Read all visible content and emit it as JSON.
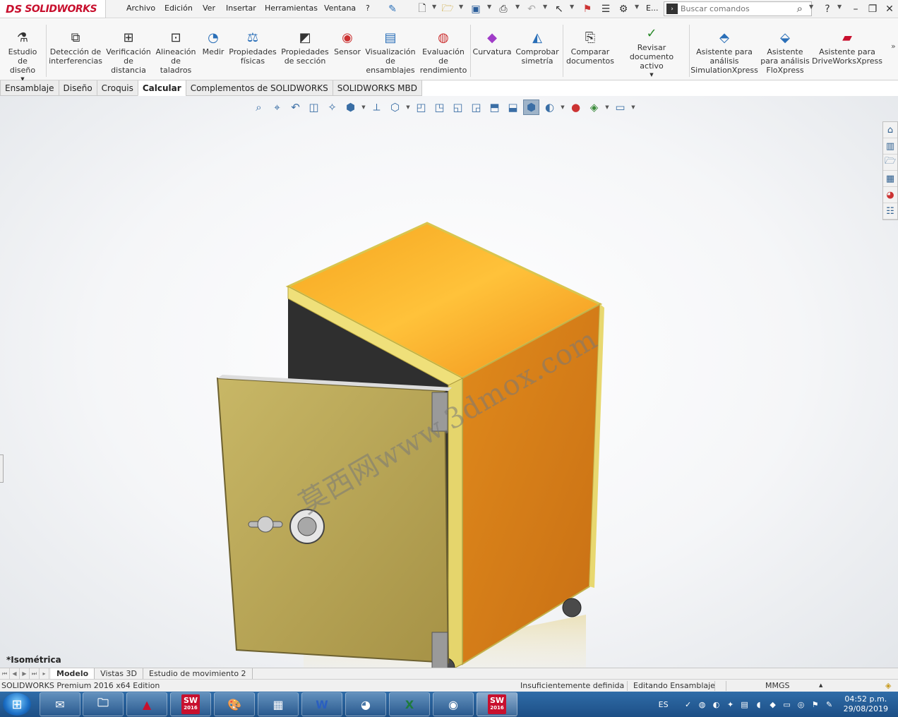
{
  "app": {
    "logo_ds": "DS",
    "logo_brand": "SOLIDWORKS"
  },
  "menu": [
    "Archivo",
    "Edición",
    "Ver",
    "Insertar",
    "Herramientas",
    "Ventana",
    "?"
  ],
  "quick_access": {
    "overflow_label": "E..."
  },
  "search": {
    "placeholder": "Buscar comandos"
  },
  "commands": [
    {
      "label": "Estudio de\ndiseño",
      "icon": "design-study-icon"
    },
    {
      "label": "Detección de\ninterferencias",
      "icon": "interference-icon"
    },
    {
      "label": "Verificación\nde\ndistancia",
      "icon": "clearance-icon"
    },
    {
      "label": "Alineación\nde\ntaladros",
      "icon": "hole-alignment-icon"
    },
    {
      "label": "Medir",
      "icon": "measure-icon"
    },
    {
      "label": "Propiedades\nfísicas",
      "icon": "mass-properties-icon"
    },
    {
      "label": "Propiedades\nde sección",
      "icon": "section-properties-icon"
    },
    {
      "label": "Sensor",
      "icon": "sensor-icon"
    },
    {
      "label": "Visualización\nde\nensamblajes",
      "icon": "assembly-visualization-icon"
    },
    {
      "label": "Evaluación\nde\nrendimiento",
      "icon": "performance-evaluation-icon"
    },
    {
      "label": "Curvatura",
      "icon": "curvature-icon"
    },
    {
      "label": "Comprobar\nsimetría",
      "icon": "symmetry-check-icon"
    },
    {
      "label": "Comparar\ndocumentos",
      "icon": "compare-documents-icon"
    },
    {
      "label": "Revisar\ndocumento activo",
      "icon": "check-active-document-icon"
    },
    {
      "label": "Asistente para\nanálisis\nSimulationXpress",
      "icon": "simulationxpress-icon"
    },
    {
      "label": "Asistente\npara análisis\nFloXpress",
      "icon": "floxpress-icon"
    },
    {
      "label": "Asistente para\nDriveWorksXpress",
      "icon": "driveworksxpress-icon"
    }
  ],
  "tabs": [
    "Ensamblaje",
    "Diseño",
    "Croquis",
    "Calcular",
    "Complementos de SOLIDWORKS",
    "SOLIDWORKS MBD"
  ],
  "active_tab": "Calcular",
  "viewport": {
    "view_name": "*Isométrica",
    "watermark": "莫西网www.3dmox.com"
  },
  "model_tabs": [
    "Modelo",
    "Vistas 3D",
    "Estudio de movimiento 2"
  ],
  "status": {
    "edition": "SOLIDWORKS Premium 2016 x64 Edition",
    "definition": "Insuficientemente definida",
    "editing": "Editando Ensamblaje",
    "units": "MMGS"
  },
  "taskbar": {
    "sw_label": "SW",
    "sw_year": "2016",
    "lang": "ES",
    "time": "04:52 p.m.",
    "date": "29/08/2019"
  },
  "colors": {
    "accent": "#c8102e",
    "cabinet_body": "#e8921a",
    "door": "#b9a85a",
    "frame": "#e9dc6a"
  }
}
